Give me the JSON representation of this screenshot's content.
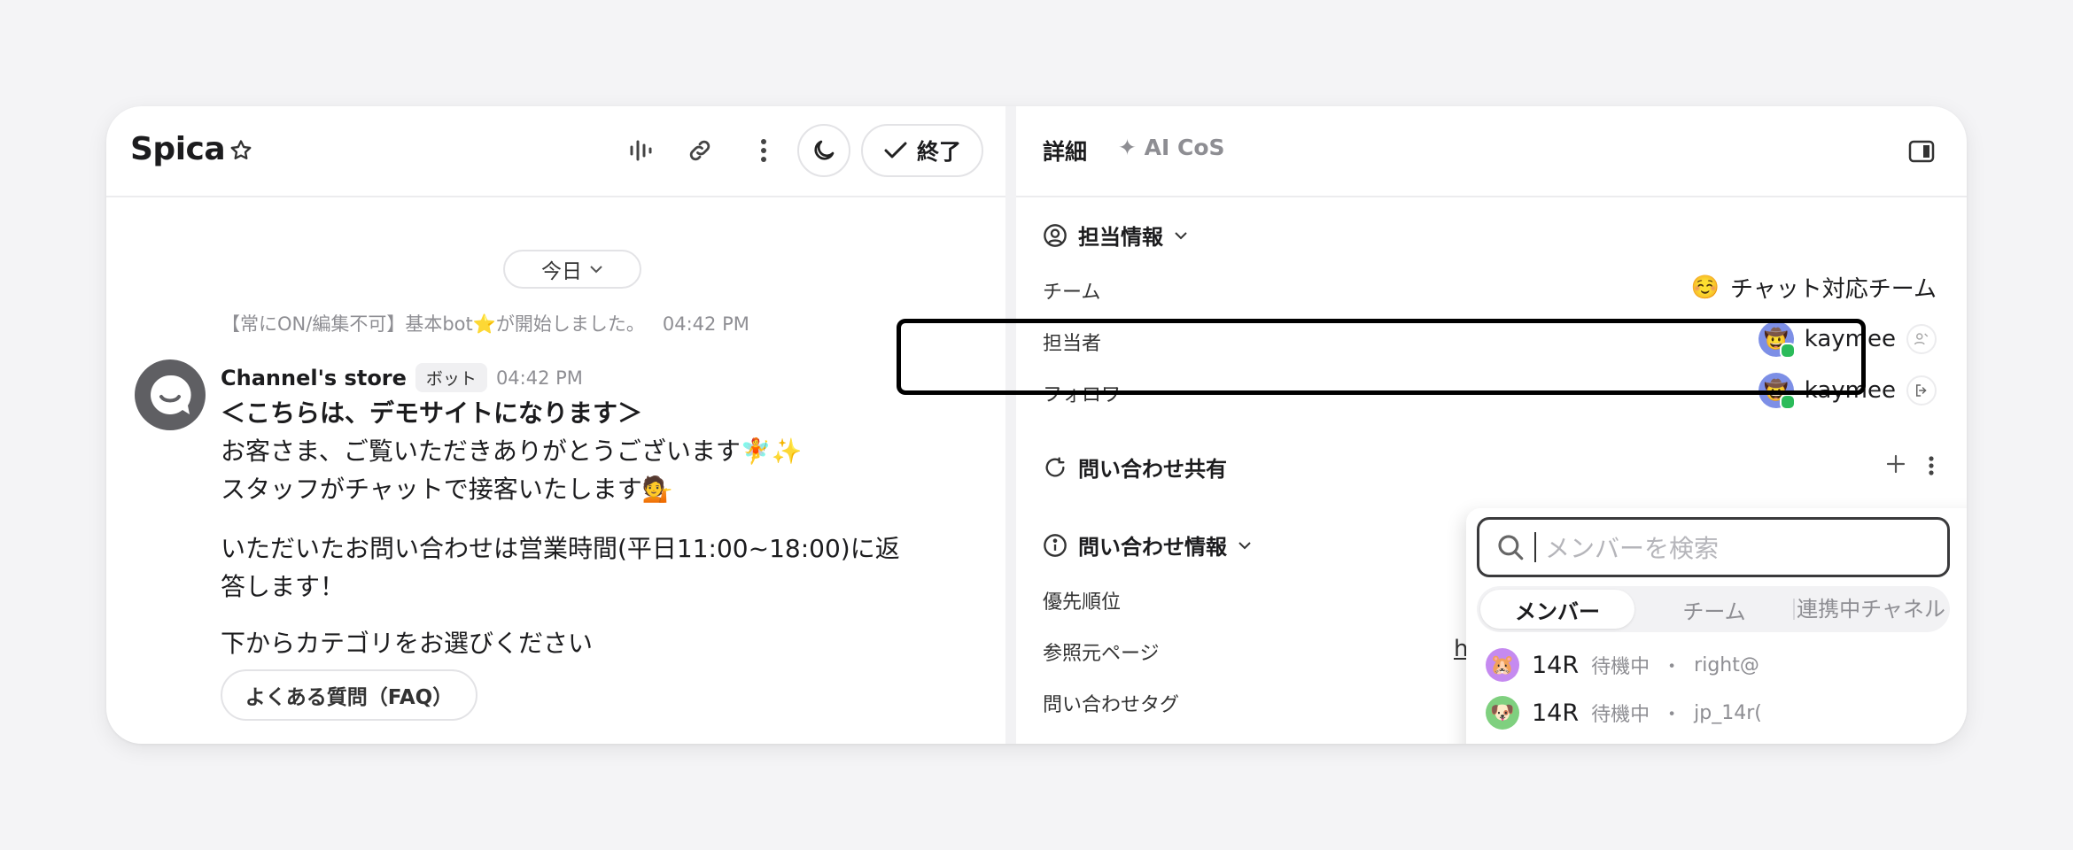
{
  "chat": {
    "title": "Spica",
    "end_label": "終了",
    "date_chip": "今日",
    "system_message": "【常にON/編集不可】基本bot⭐が開始しました。",
    "system_time": "04:42 PM",
    "sender_name": "Channel's store",
    "sender_badge": "ボット",
    "sender_time": "04:42 PM",
    "message_lines": [
      "＜こちらは、デモサイトになります＞",
      "お客さま、ご覧いただきありがとうございます🧚✨",
      "スタッフがチャットで接客いたします💁",
      "いただいたお問い合わせは営業時間(平日11:00~18:00)に返",
      "答します！",
      "下からカテゴリをお選びください"
    ],
    "faq_button": "よくある質問（FAQ）"
  },
  "details": {
    "tab_details": "詳細",
    "tab_ai": "✦ AI CoS",
    "assign_section": "担当情報",
    "team_label": "チーム",
    "team_value": "チャット対応チーム",
    "team_emoji": "☺️",
    "assignee_label": "担当者",
    "assignee_value": "kaymee",
    "follower_label": "フォロワー",
    "follower_value": "kaymee",
    "share_section": "問い合わせ共有",
    "info_section": "問い合わせ情報",
    "priority_label": "優先順位",
    "ref_page_label": "参照元ページ",
    "ref_page_value": "h",
    "tags_label": "問い合わせタグ"
  },
  "member_picker": {
    "search_placeholder": "メンバーを検索",
    "tabs": [
      "メンバー",
      "チーム",
      "連携中チャネル"
    ],
    "active_tab": "メンバー",
    "members": [
      {
        "name": "14R",
        "status": "待機中",
        "sep": "・",
        "handle": "right@",
        "emoji": "🐹",
        "color": "#c58af0"
      },
      {
        "name": "14R",
        "status": "待機中",
        "sep": "・",
        "handle": "jp_14r(",
        "emoji": "🐶",
        "color": "#7fd07f"
      }
    ]
  },
  "colors": {
    "accent_dark": "#1c1c1e",
    "online_green": "#2bbb5a",
    "muted_text": "#8e8e93"
  }
}
